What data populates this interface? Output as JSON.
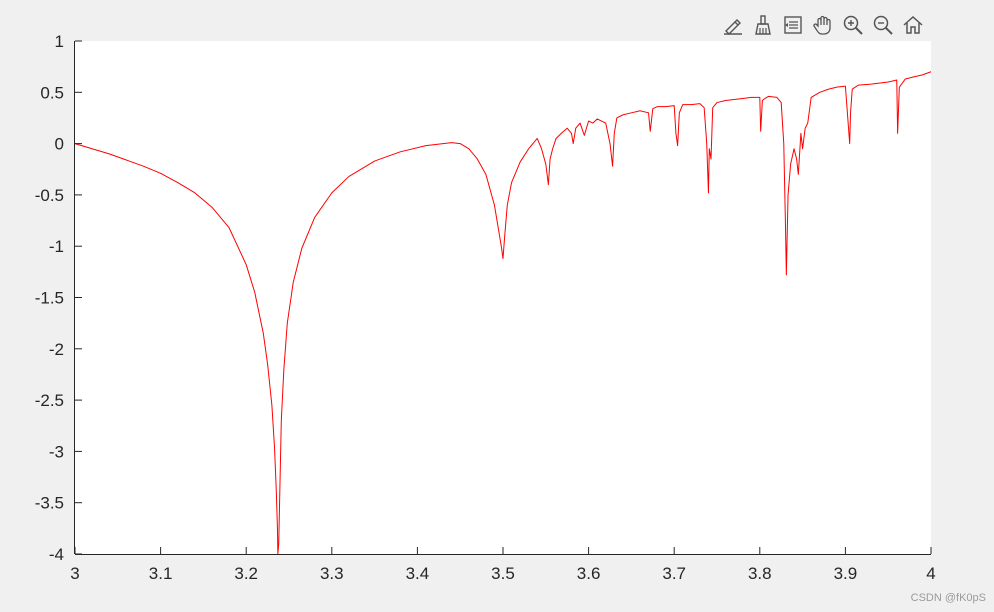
{
  "toolbar": {
    "buttons": [
      {
        "name": "brush-edit-icon"
      },
      {
        "name": "data-brush-icon"
      },
      {
        "name": "datatip-icon"
      },
      {
        "name": "pan-hand-icon"
      },
      {
        "name": "zoom-in-icon"
      },
      {
        "name": "zoom-out-icon"
      },
      {
        "name": "home-icon"
      }
    ]
  },
  "watermark": "CSDN @fK0pS",
  "chart_data": {
    "type": "line",
    "title": "",
    "xlabel": "",
    "ylabel": "",
    "xlim": [
      3,
      4
    ],
    "ylim": [
      -4,
      1
    ],
    "grid": false,
    "x_ticks": [
      "3",
      "3.1",
      "3.2",
      "3.3",
      "3.4",
      "3.5",
      "3.6",
      "3.7",
      "3.8",
      "3.9",
      "4"
    ],
    "y_ticks": [
      "1",
      "0.5",
      "0",
      "-0.5",
      "-1",
      "-1.5",
      "-2",
      "-2.5",
      "-3",
      "-3.5",
      "-4"
    ],
    "colors": {
      "line": "#ff0000",
      "axes_bg": "#ffffff",
      "figure_bg": "#f0f0f0",
      "axis": "#262626"
    },
    "series": [
      {
        "x": [
          3.0,
          3.02,
          3.04,
          3.06,
          3.08,
          3.1,
          3.12,
          3.14,
          3.16,
          3.18,
          3.2,
          3.21,
          3.22,
          3.225,
          3.23,
          3.233,
          3.235,
          3.2365,
          3.237,
          3.238,
          3.2395,
          3.241,
          3.244,
          3.248,
          3.255,
          3.265,
          3.28,
          3.3,
          3.32,
          3.35,
          3.38,
          3.41,
          3.44,
          3.45,
          3.46,
          3.47,
          3.48,
          3.49,
          3.495,
          3.498,
          3.5,
          3.502,
          3.505,
          3.51,
          3.52,
          3.53,
          3.54,
          3.545,
          3.55,
          3.553,
          3.555,
          3.558,
          3.562,
          3.568,
          3.575,
          3.58,
          3.582,
          3.585,
          3.59,
          3.595,
          3.6,
          3.605,
          3.61,
          3.62,
          3.625,
          3.628,
          3.63,
          3.633,
          3.64,
          3.65,
          3.66,
          3.67,
          3.672,
          3.675,
          3.68,
          3.69,
          3.7,
          3.702,
          3.704,
          3.706,
          3.71,
          3.72,
          3.73,
          3.735,
          3.738,
          3.74,
          3.741,
          3.743,
          3.745,
          3.75,
          3.76,
          3.77,
          3.78,
          3.79,
          3.8,
          3.801,
          3.803,
          3.806,
          3.81,
          3.82,
          3.825,
          3.828,
          3.83,
          3.831,
          3.833,
          3.836,
          3.84,
          3.843,
          3.845,
          3.848,
          3.85,
          3.853,
          3.856,
          3.86,
          3.87,
          3.88,
          3.89,
          3.9,
          3.905,
          3.906,
          3.908,
          3.915,
          3.93,
          3.95,
          3.96,
          3.961,
          3.963,
          3.97,
          3.98,
          3.99,
          4.0
        ],
        "y": [
          0.0,
          -0.05,
          -0.1,
          -0.16,
          -0.22,
          -0.29,
          -0.38,
          -0.48,
          -0.62,
          -0.82,
          -1.18,
          -1.45,
          -1.85,
          -2.15,
          -2.55,
          -2.95,
          -3.35,
          -3.75,
          -4.0,
          -3.9,
          -3.3,
          -2.7,
          -2.2,
          -1.75,
          -1.35,
          -1.02,
          -0.72,
          -0.48,
          -0.32,
          -0.17,
          -0.08,
          -0.02,
          0.01,
          0.0,
          -0.05,
          -0.15,
          -0.3,
          -0.6,
          -0.85,
          -1.0,
          -1.12,
          -0.9,
          -0.6,
          -0.38,
          -0.18,
          -0.05,
          0.05,
          -0.05,
          -0.2,
          -0.4,
          -0.15,
          -0.05,
          0.05,
          0.1,
          0.15,
          0.1,
          0.0,
          0.15,
          0.2,
          0.08,
          0.22,
          0.2,
          0.24,
          0.2,
          0.0,
          -0.22,
          0.1,
          0.25,
          0.28,
          0.3,
          0.32,
          0.3,
          0.12,
          0.34,
          0.36,
          0.36,
          0.37,
          0.1,
          -0.02,
          0.3,
          0.38,
          0.38,
          0.39,
          0.35,
          0.0,
          -0.48,
          -0.05,
          -0.15,
          0.35,
          0.4,
          0.42,
          0.43,
          0.44,
          0.45,
          0.45,
          0.12,
          0.42,
          0.44,
          0.46,
          0.45,
          0.4,
          0.0,
          -0.8,
          -1.28,
          -0.5,
          -0.2,
          -0.05,
          -0.15,
          -0.3,
          0.1,
          -0.05,
          0.15,
          0.2,
          0.45,
          0.5,
          0.53,
          0.55,
          0.56,
          0.0,
          0.3,
          0.53,
          0.57,
          0.58,
          0.6,
          0.62,
          0.1,
          0.55,
          0.63,
          0.65,
          0.67,
          0.7
        ]
      }
    ]
  }
}
